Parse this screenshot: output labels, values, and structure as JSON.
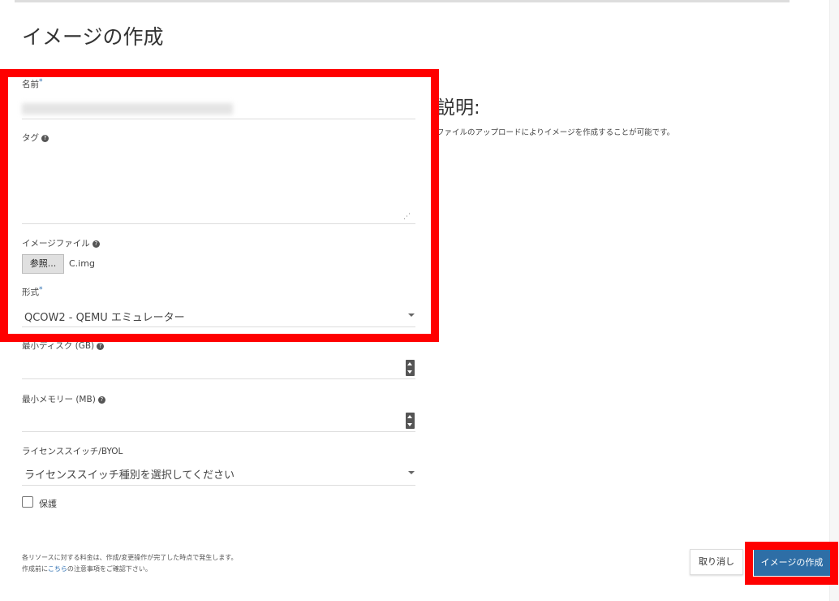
{
  "title": "イメージの作成",
  "form": {
    "name_label": "名前",
    "tag_label": "タグ",
    "image_file_label": "イメージファイル",
    "browse_button": "参照...",
    "file_name": "C.img",
    "format_label": "形式",
    "format_value": "QCOW2 - QEMU エミュレーター",
    "min_disk_label": "最小ディスク (GB)",
    "min_memory_label": "最小メモリー (MB)",
    "license_label": "ライセンススイッチ/BYOL",
    "license_value": "ライセンススイッチ種別を選択してください",
    "protect_label": "保護",
    "required_mark": "*",
    "help_mark": "?"
  },
  "description": {
    "heading": "説明:",
    "text": "ファイルのアップロードによりイメージを作成することが可能です。"
  },
  "footer": {
    "note1": "各リソースに対する料金は、作成/変更操作が完了した時点で発生します。",
    "note2_pre": "作成前に",
    "note2_link": "こちら",
    "note2_post": "の注意事項をご確認下さい。",
    "cancel": "取り消し",
    "create": "イメージの作成"
  }
}
